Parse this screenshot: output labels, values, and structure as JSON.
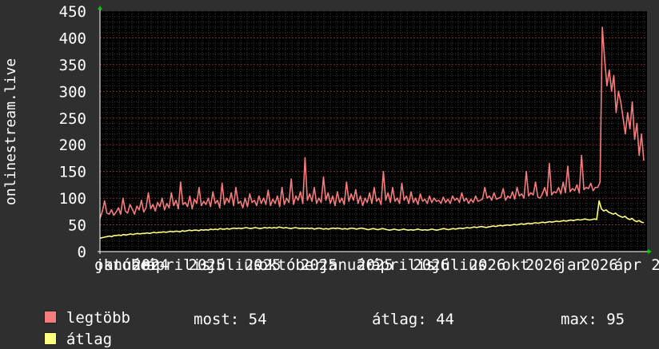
{
  "chart_data": {
    "type": "line",
    "ylabel": "onlinestream.live",
    "ylim": [
      0,
      450
    ],
    "yticks": [
      0,
      50,
      100,
      150,
      200,
      250,
      300,
      350,
      400,
      450
    ],
    "xtick_labels": [
      "október",
      "január",
      "2024",
      "április",
      "2025",
      "július",
      "2025",
      "október",
      "2025",
      "január",
      "2025",
      "április",
      "2026",
      "július",
      "2026",
      "okt",
      "2026",
      "jan",
      "2026",
      "ápr",
      "2"
    ],
    "grid": true,
    "background": "#000000",
    "series": [
      {
        "name": "legtöbb",
        "color": "#f47c7c",
        "values": [
          62,
          75,
          95,
          72,
          70,
          78,
          68,
          74,
          82,
          70,
          100,
          76,
          72,
          88,
          80,
          70,
          85,
          78,
          96,
          74,
          82,
          110,
          80,
          88,
          76,
          92,
          84,
          100,
          78,
          90,
          82,
          110,
          86,
          96,
          80,
          130,
          88,
          92,
          84,
          104,
          80,
          98,
          90,
          120,
          86,
          94,
          88,
          100,
          84,
          112,
          90,
          96,
          82,
          128,
          88,
          100,
          92,
          110,
          86,
          120,
          90,
          94,
          82,
          100,
          84,
          108,
          92,
          96,
          86,
          104,
          90,
          100,
          88,
          115,
          86,
          98,
          90,
          104,
          84,
          120,
          88,
          100,
          92,
          136,
          88,
          104,
          96,
          112,
          90,
          176,
          96,
          108,
          94,
          120,
          90,
          100,
          92,
          140,
          96,
          110,
          90,
          104,
          86,
          112,
          92,
          100,
          88,
          130,
          94,
          108,
          96,
          116,
          90,
          104,
          86,
          100,
          92,
          110,
          90,
          120,
          94,
          100,
          88,
          150,
          96,
          110,
          92,
          120,
          94,
          100,
          90,
          128,
          96,
          104,
          90,
          112,
          92,
          100,
          88,
          108,
          94,
          98,
          90,
          104,
          92,
          100,
          94,
          96,
          90,
          102,
          92,
          98,
          90,
          104,
          96,
          100,
          92,
          110,
          94,
          100,
          90,
          98,
          92,
          104,
          94,
          96,
          98,
          120,
          100,
          104,
          96,
          110,
          98,
          100,
          102,
          118,
          96,
          104,
          100,
          112,
          98,
          120,
          104,
          108,
          100,
          150,
          104,
          110,
          106,
          130,
          102,
          100,
          108,
          120,
          104,
          165,
          106,
          112,
          110,
          120,
          108,
          130,
          110,
          160,
          112,
          118,
          114,
          125,
          110,
          180,
          116,
          120,
          118,
          128,
          114,
          120,
          120,
          130,
          420,
          360,
          310,
          340,
          300,
          330,
          260,
          300,
          280,
          250,
          220,
          260,
          230,
          280,
          210,
          240,
          180,
          220,
          170
        ]
      },
      {
        "name": "átlag",
        "color": "#ffff80",
        "values": [
          25,
          26,
          27,
          28,
          29,
          28,
          30,
          30,
          31,
          30,
          32,
          31,
          32,
          33,
          32,
          33,
          34,
          33,
          34,
          34,
          35,
          34,
          35,
          36,
          35,
          36,
          36,
          37,
          36,
          37,
          38,
          37,
          38,
          38,
          37,
          39,
          38,
          39,
          40,
          39,
          40,
          40,
          39,
          41,
          40,
          41,
          40,
          42,
          41,
          42,
          41,
          43,
          42,
          42,
          43,
          42,
          43,
          44,
          43,
          44,
          43,
          44,
          45,
          44,
          43,
          44,
          45,
          44,
          43,
          44,
          45,
          44,
          45,
          44,
          45,
          44,
          46,
          45,
          44,
          45,
          44,
          43,
          44,
          45,
          44,
          43,
          44,
          43,
          44,
          43,
          44,
          42,
          43,
          44,
          43,
          42,
          43,
          42,
          43,
          44,
          43,
          44,
          43,
          42,
          43,
          42,
          43,
          44,
          43,
          42,
          43,
          44,
          43,
          42,
          41,
          42,
          43,
          42,
          41,
          42,
          43,
          42,
          41,
          40,
          41,
          42,
          41,
          40,
          41,
          42,
          41,
          40,
          41,
          40,
          41,
          42,
          41,
          40,
          41,
          40,
          41,
          42,
          41,
          40,
          41,
          42,
          43,
          42,
          41,
          42,
          43,
          42,
          43,
          44,
          43,
          44,
          45,
          44,
          45,
          46,
          45,
          46,
          47,
          46,
          45,
          46,
          47,
          48,
          47,
          48,
          49,
          48,
          49,
          50,
          49,
          50,
          51,
          50,
          51,
          52,
          51,
          52,
          53,
          52,
          53,
          54,
          53,
          54,
          55,
          54,
          55,
          56,
          55,
          56,
          57,
          56,
          57,
          58,
          57,
          58,
          59,
          58,
          59,
          60,
          59,
          60,
          61,
          60,
          59,
          60,
          61,
          60,
          95,
          80,
          76,
          78,
          74,
          72,
          70,
          72,
          68,
          66,
          64,
          66,
          62,
          60,
          62,
          58,
          56,
          58,
          55,
          54
        ]
      }
    ],
    "legend": [
      {
        "label": "legtöbb",
        "color": "#f47c7c"
      },
      {
        "label": "átlag",
        "color": "#ffff80"
      }
    ],
    "stats": {
      "most": "most: 54",
      "atlag": "átlag: 44",
      "max": "max: 95"
    }
  }
}
